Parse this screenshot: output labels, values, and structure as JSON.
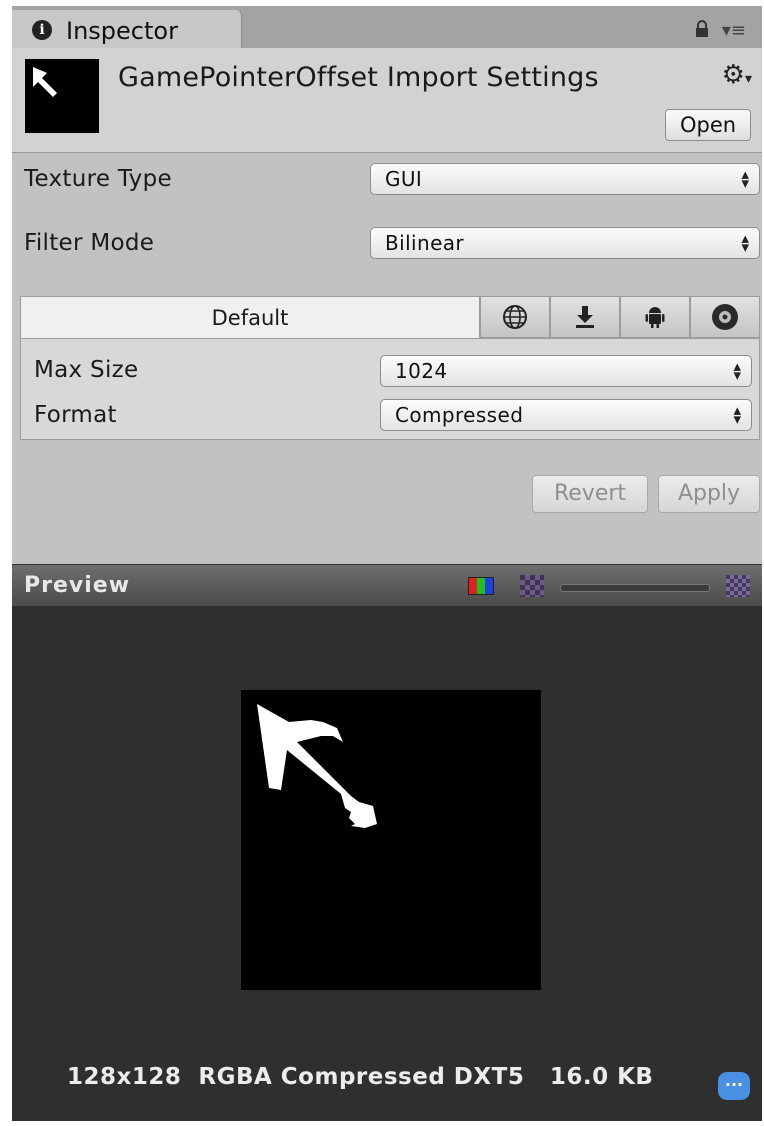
{
  "tab": {
    "title": "Inspector",
    "info_icon": "i"
  },
  "header": {
    "title": "GamePointerOffset Import Settings",
    "open_label": "Open"
  },
  "fields": {
    "texture_type": {
      "label": "Texture Type",
      "value": "GUI"
    },
    "filter_mode": {
      "label": "Filter Mode",
      "value": "Bilinear"
    }
  },
  "platform": {
    "default_tab": "Default",
    "icons": [
      "globe-icon",
      "download-icon",
      "android-icon",
      "disc-icon"
    ],
    "max_size": {
      "label": "Max Size",
      "value": "1024"
    },
    "format": {
      "label": "Format",
      "value": "Compressed"
    }
  },
  "actions": {
    "revert_label": "Revert",
    "apply_label": "Apply"
  },
  "preview": {
    "title": "Preview",
    "info": "128x128  RGBA Compressed DXT5   16.0 KB",
    "chat_badge": "..."
  },
  "colors": {
    "panel": "#c2c2c2",
    "preview_bg": "#2f2f2f",
    "badge": "#4a90e2"
  }
}
